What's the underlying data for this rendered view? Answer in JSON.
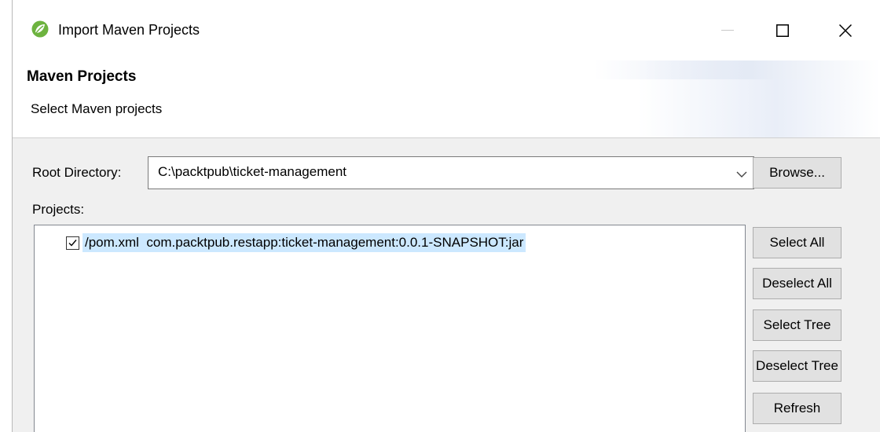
{
  "window": {
    "title": "Import Maven Projects",
    "icon": "spring-leaf-icon",
    "controls": {
      "minimize_icon": "minimize-icon",
      "maximize_icon": "maximize-icon",
      "close_icon": "close-icon"
    }
  },
  "banner": {
    "title": "Maven Projects",
    "description": "Select Maven projects"
  },
  "root": {
    "label": "Root Directory:",
    "value": "C:\\packtpub\\ticket-management",
    "browse_label": "Browse..."
  },
  "projects": {
    "label": "Projects:",
    "items": [
      {
        "checked": true,
        "text": "/pom.xml  com.packtpub.restapp:ticket-management:0.0.1-SNAPSHOT:jar"
      }
    ]
  },
  "buttons": {
    "select_all": "Select All",
    "deselect_all": "Deselect All",
    "select_tree": "Select Tree",
    "deselect_tree": "Deselect Tree",
    "refresh": "Refresh"
  },
  "colors": {
    "selection": "#cce8ff",
    "spring_green": "#6db33f",
    "dialog_bg": "#f0f0f0"
  }
}
